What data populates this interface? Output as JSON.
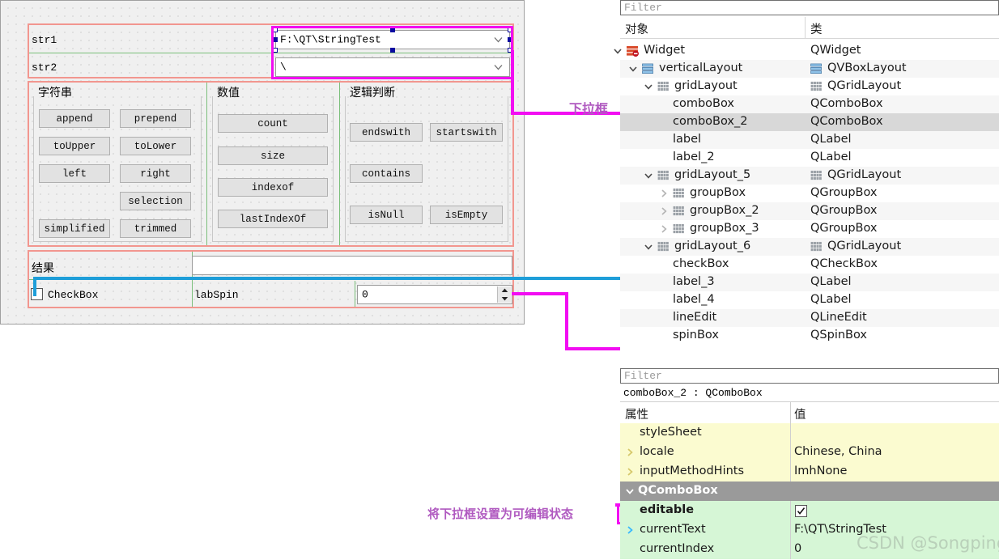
{
  "form": {
    "labels": {
      "str1": "str1",
      "str2": "str2",
      "result": "结果",
      "checkbox": "CheckBox",
      "labspin": "labSpin"
    },
    "combo1_value": "F:\\QT\\StringTest",
    "combo2_value": "\\",
    "spin_value": "0",
    "groups": [
      {
        "title": "字符串",
        "buttons": [
          "append",
          "prepend",
          "toUpper",
          "toLower",
          "left",
          "right",
          "selection",
          "simplified",
          "trimmed"
        ]
      },
      {
        "title": "数值",
        "buttons": [
          "count",
          "size",
          "indexof",
          "lastIndexOf"
        ]
      },
      {
        "title": "逻辑判断",
        "buttons": [
          "endswith",
          "startswith",
          "contains",
          "isNull",
          "isEmpty"
        ]
      }
    ]
  },
  "annotations": {
    "dropdown": "下拉框",
    "editable": "将下拉框设置为可编辑状态",
    "accent_magenta": "#f20df2",
    "accent_blue": "#1e9ed9"
  },
  "object_inspector": {
    "filter_placeholder": "Filter",
    "columns": {
      "name": "对象",
      "class": "类"
    },
    "rows": [
      {
        "name": "Widget",
        "class": "QWidget",
        "indent": 0,
        "chevron": "down",
        "icon": "widget-icon",
        "class_icon": "none",
        "selected": false
      },
      {
        "name": "verticalLayout",
        "class": "QVBoxLayout",
        "indent": 1,
        "chevron": "down",
        "icon": "vbox-icon",
        "class_icon": "vbox-icon",
        "selected": false
      },
      {
        "name": "gridLayout",
        "class": "QGridLayout",
        "indent": 2,
        "chevron": "down",
        "icon": "grid-icon",
        "class_icon": "grid-icon",
        "selected": false
      },
      {
        "name": "comboBox",
        "class": "QComboBox",
        "indent": 3,
        "chevron": "none",
        "icon": "none",
        "class_icon": "none",
        "selected": false
      },
      {
        "name": "comboBox_2",
        "class": "QComboBox",
        "indent": 3,
        "chevron": "none",
        "icon": "none",
        "class_icon": "none",
        "selected": true
      },
      {
        "name": "label",
        "class": "QLabel",
        "indent": 3,
        "chevron": "none",
        "icon": "none",
        "class_icon": "none",
        "selected": false
      },
      {
        "name": "label_2",
        "class": "QLabel",
        "indent": 3,
        "chevron": "none",
        "icon": "none",
        "class_icon": "none",
        "selected": false
      },
      {
        "name": "gridLayout_5",
        "class": "QGridLayout",
        "indent": 2,
        "chevron": "down",
        "icon": "grid-icon",
        "class_icon": "grid-icon",
        "selected": false
      },
      {
        "name": "groupBox",
        "class": "QGroupBox",
        "indent": 3,
        "chevron": "right",
        "icon": "grid-icon",
        "class_icon": "none",
        "selected": false
      },
      {
        "name": "groupBox_2",
        "class": "QGroupBox",
        "indent": 3,
        "chevron": "right",
        "icon": "grid-icon",
        "class_icon": "none",
        "selected": false
      },
      {
        "name": "groupBox_3",
        "class": "QGroupBox",
        "indent": 3,
        "chevron": "right",
        "icon": "grid-icon",
        "class_icon": "none",
        "selected": false
      },
      {
        "name": "gridLayout_6",
        "class": "QGridLayout",
        "indent": 2,
        "chevron": "down",
        "icon": "grid-icon",
        "class_icon": "grid-icon",
        "selected": false
      },
      {
        "name": "checkBox",
        "class": "QCheckBox",
        "indent": 3,
        "chevron": "none",
        "icon": "none",
        "class_icon": "none",
        "selected": false
      },
      {
        "name": "label_3",
        "class": "QLabel",
        "indent": 3,
        "chevron": "none",
        "icon": "none",
        "class_icon": "none",
        "selected": false
      },
      {
        "name": "label_4",
        "class": "QLabel",
        "indent": 3,
        "chevron": "none",
        "icon": "none",
        "class_icon": "none",
        "selected": false
      },
      {
        "name": "lineEdit",
        "class": "QLineEdit",
        "indent": 3,
        "chevron": "none",
        "icon": "none",
        "class_icon": "none",
        "selected": false
      },
      {
        "name": "spinBox",
        "class": "QSpinBox",
        "indent": 3,
        "chevron": "none",
        "icon": "none",
        "class_icon": "none",
        "selected": false
      }
    ]
  },
  "property_editor": {
    "filter_placeholder": "Filter",
    "object_header": "comboBox_2 : QComboBox",
    "columns": {
      "property": "属性",
      "value": "值"
    },
    "rows": [
      {
        "name": "styleSheet",
        "value": "",
        "band": "yellow",
        "chevron": "none",
        "bold": false,
        "checkbox": false
      },
      {
        "name": "locale",
        "value": "Chinese, China",
        "band": "yellow",
        "chevron": "right",
        "bold": false,
        "checkbox": false
      },
      {
        "name": "inputMethodHints",
        "value": "ImhNone",
        "band": "yellow",
        "chevron": "right",
        "bold": false,
        "checkbox": false
      },
      {
        "name": "QComboBox",
        "value": "",
        "band": "gray",
        "chevron": "down",
        "bold": true,
        "checkbox": false
      },
      {
        "name": "editable",
        "value": "",
        "band": "green",
        "chevron": "none",
        "bold": true,
        "checkbox": true
      },
      {
        "name": "currentText",
        "value": "F:\\QT\\StringTest",
        "band": "green",
        "chevron": "right",
        "bold": false,
        "checkbox": false
      },
      {
        "name": "currentIndex",
        "value": "0",
        "band": "green",
        "chevron": "none",
        "bold": false,
        "checkbox": false
      }
    ]
  },
  "watermark": "CSDN @SongpingWang"
}
